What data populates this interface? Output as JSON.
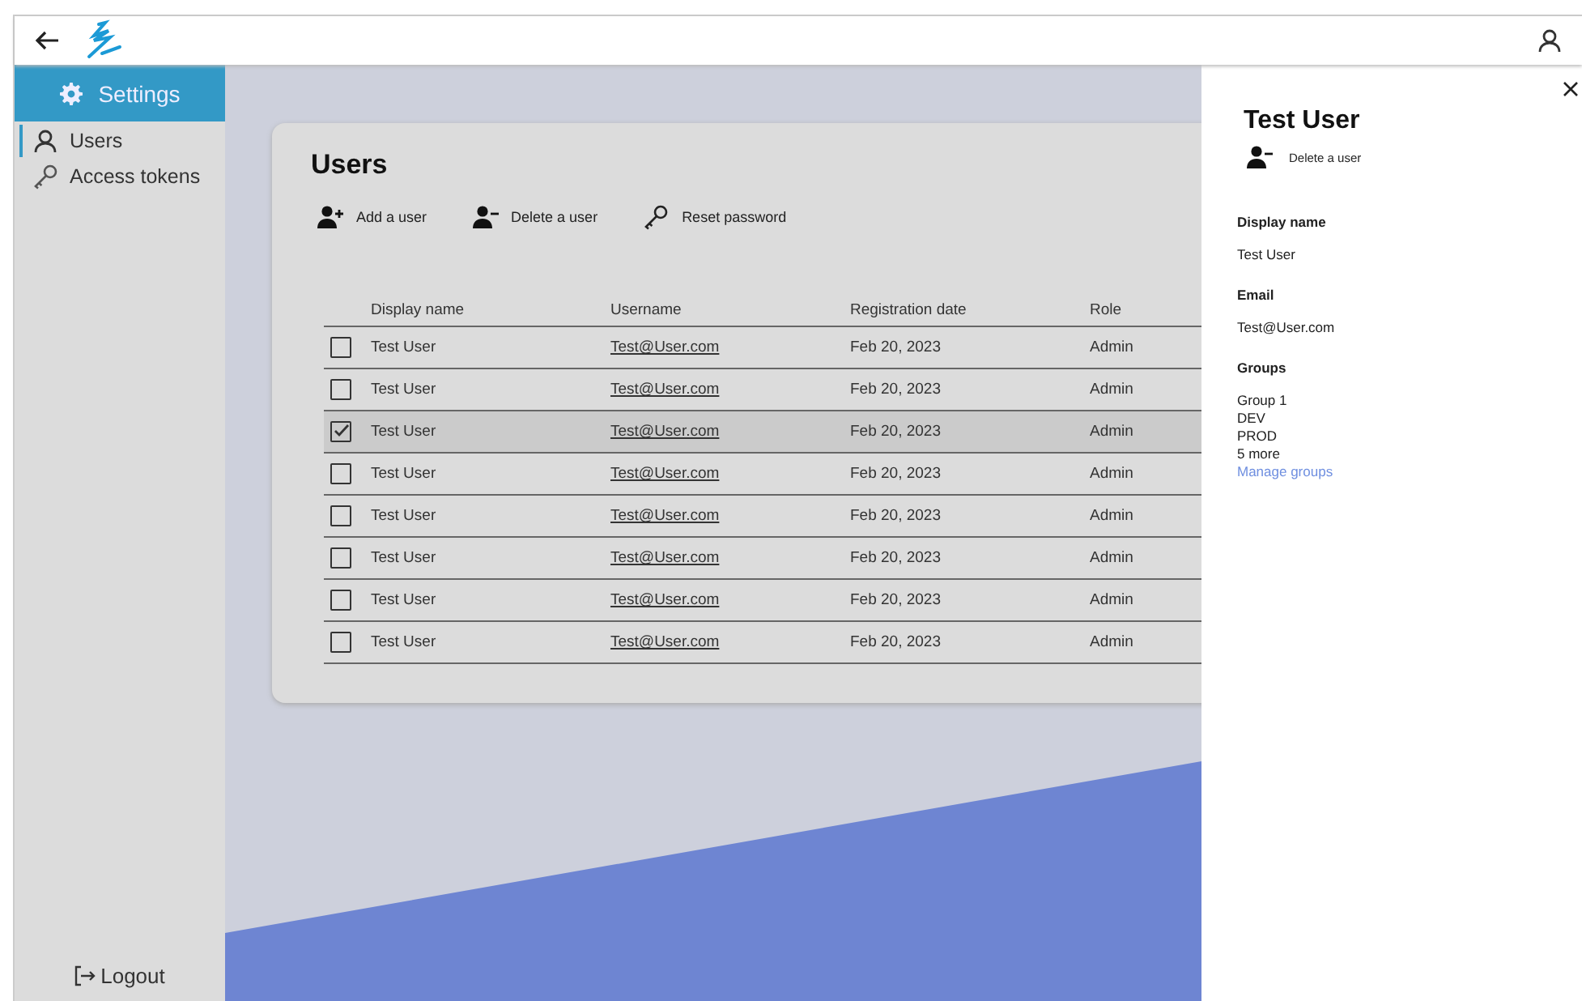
{
  "sidebar": {
    "header": "Settings",
    "items": [
      {
        "label": "Users",
        "selected": true
      },
      {
        "label": "Access tokens",
        "selected": false
      }
    ],
    "logout": "Logout"
  },
  "card": {
    "title": "Users",
    "actions": [
      {
        "label": "Add a user"
      },
      {
        "label": "Delete a user"
      },
      {
        "label": "Reset password"
      }
    ],
    "table": {
      "columns": [
        "Display name",
        "Username",
        "Registration date",
        "Role"
      ],
      "rows": [
        {
          "name": "Test User",
          "username": "Test@User.com",
          "date": "Feb 20, 2023",
          "role": "Admin",
          "selected": false
        },
        {
          "name": "Test User",
          "username": "Test@User.com",
          "date": "Feb 20, 2023",
          "role": "Admin",
          "selected": false
        },
        {
          "name": "Test User",
          "username": "Test@User.com",
          "date": "Feb 20, 2023",
          "role": "Admin",
          "selected": true
        },
        {
          "name": "Test User",
          "username": "Test@User.com",
          "date": "Feb 20, 2023",
          "role": "Admin",
          "selected": false
        },
        {
          "name": "Test User",
          "username": "Test@User.com",
          "date": "Feb 20, 2023",
          "role": "Admin",
          "selected": false
        },
        {
          "name": "Test User",
          "username": "Test@User.com",
          "date": "Feb 20, 2023",
          "role": "Admin",
          "selected": false
        },
        {
          "name": "Test User",
          "username": "Test@User.com",
          "date": "Feb 20, 2023",
          "role": "Admin",
          "selected": false
        },
        {
          "name": "Test User",
          "username": "Test@User.com",
          "date": "Feb 20, 2023",
          "role": "Admin",
          "selected": false
        }
      ]
    }
  },
  "panel": {
    "title": "Test User",
    "action": "Delete a user",
    "fields": [
      {
        "label": "Display name",
        "values": [
          "Test User"
        ]
      },
      {
        "label": "Email",
        "values": [
          "Test@User.com"
        ]
      },
      {
        "label": "Groups",
        "values": [
          "Group 1",
          "DEV",
          "PROD",
          "5 more"
        ],
        "link": "Manage groups"
      }
    ]
  }
}
